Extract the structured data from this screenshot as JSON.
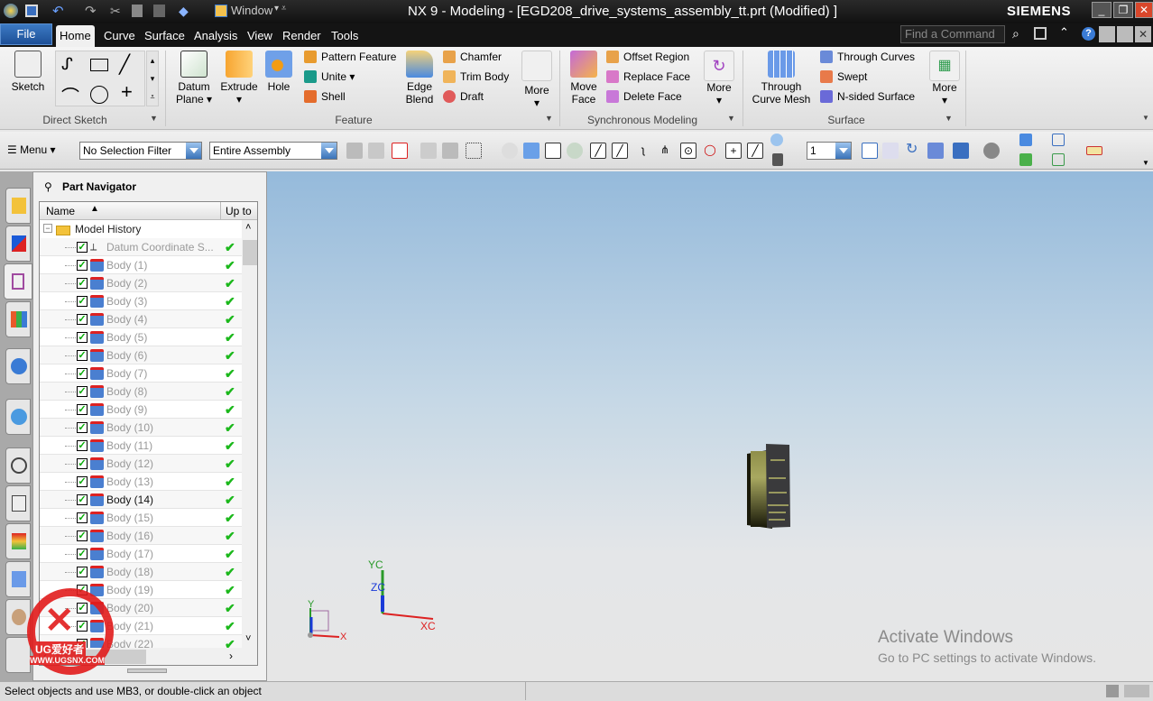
{
  "title_bar": {
    "quick_access": "Window",
    "title": "NX 9 - Modeling - [EGD208_drive_systems_assembly_tt.prt (Modified) ]",
    "brand": "SIEMENS"
  },
  "menu_tabs": [
    "File",
    "Home",
    "Curve",
    "Surface",
    "Analysis",
    "View",
    "Render",
    "Tools"
  ],
  "active_tab": "Home",
  "search": {
    "placeholder": "Find a Command"
  },
  "ribbon": {
    "direct_sketch": {
      "sketch": "Sketch",
      "label": "Direct Sketch"
    },
    "feature": {
      "datum_plane": "Datum Plane",
      "extrude": "Extrude",
      "hole": "Hole",
      "pattern_feature": "Pattern Feature",
      "unite": "Unite",
      "shell": "Shell",
      "edge_blend": "Edge Blend",
      "chamfer": "Chamfer",
      "trim_body": "Trim Body",
      "draft": "Draft",
      "more": "More",
      "label": "Feature"
    },
    "sync": {
      "move_face": "Move Face",
      "offset_region": "Offset Region",
      "replace_face": "Replace Face",
      "delete_face": "Delete Face",
      "more": "More",
      "label": "Synchronous Modeling"
    },
    "surface": {
      "through_curve_mesh": "Through Curve Mesh",
      "through_curves": "Through Curves",
      "swept": "Swept",
      "n_sided": "N-sided Surface",
      "more": "More",
      "label": "Surface"
    }
  },
  "toolbar": {
    "menu": "Menu",
    "selection_filter": "No Selection Filter",
    "scope": "Entire Assembly",
    "layer": "1"
  },
  "navigator": {
    "title": "Part Navigator",
    "col_name": "Name",
    "col_upto": "Up to",
    "root": "Model History",
    "items": [
      "Datum Coordinate S...",
      "Body (1)",
      "Body (2)",
      "Body (3)",
      "Body (4)",
      "Body (5)",
      "Body (6)",
      "Body (7)",
      "Body (8)",
      "Body (9)",
      "Body (10)",
      "Body (11)",
      "Body (12)",
      "Body (13)",
      "Body (14)",
      "Body (15)",
      "Body (16)",
      "Body (17)",
      "Body (18)",
      "Body (19)",
      "Body (20)",
      "Body (21)",
      "Body (22)"
    ],
    "active_item": "Body (14)"
  },
  "viewport": {
    "axes": {
      "yc": "YC",
      "zc": "ZC",
      "xc": "XC",
      "y": "Y",
      "x": "X"
    },
    "watermark_title": "Activate Windows",
    "watermark_sub": "Go to PC settings to activate Windows."
  },
  "logo": {
    "text": "UG爱好者",
    "url": "WWW.UGSNX.COM"
  },
  "status": "Select objects and use MB3, or double-click an object"
}
